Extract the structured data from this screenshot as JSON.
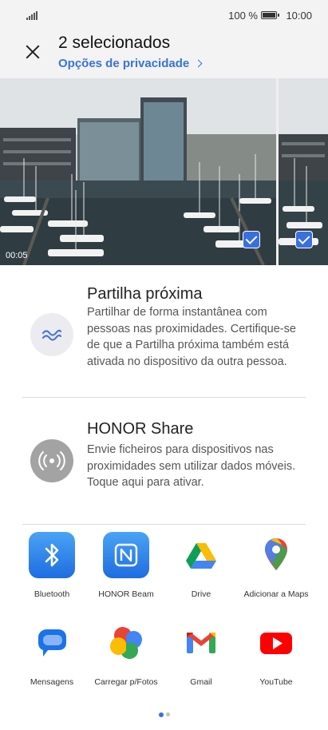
{
  "status": {
    "battery": "100 %",
    "time": "10:00"
  },
  "header": {
    "title": "2 selecionados",
    "privacy_link": "Opções de privacidade"
  },
  "media": [
    {
      "duration": "00:05",
      "selected": true
    },
    {
      "selected": true
    }
  ],
  "share_options": [
    {
      "title": "Partilha próxima",
      "description": "Partilhar de forma instantânea com pessoas nas proximidades. Certifique-se de que a Partilha próxima também está ativada no dispositivo da outra pessoa.",
      "icon": "nearby-share-icon"
    },
    {
      "title": "HONOR Share",
      "description": "Envie ficheiros para dispositivos nas proximidades sem utilizar dados móveis. Toque aqui para ativar.",
      "icon": "honor-share-icon"
    }
  ],
  "apps": [
    {
      "label": "Bluetooth",
      "icon": "bluetooth-icon"
    },
    {
      "label": "HONOR Beam",
      "icon": "nfc-icon"
    },
    {
      "label": "Drive",
      "icon": "drive-icon"
    },
    {
      "label": "Adicionar a Maps",
      "icon": "maps-icon"
    },
    {
      "label": "Mensagens",
      "icon": "messages-icon"
    },
    {
      "label": "Carregar p/Fotos",
      "icon": "photos-icon"
    },
    {
      "label": "Gmail",
      "icon": "gmail-icon"
    },
    {
      "label": "YouTube",
      "icon": "youtube-icon"
    }
  ],
  "pager": {
    "pages": 2,
    "current": 1
  },
  "colors": {
    "accent": "#3a72d8",
    "header_bg": "#f3f3f3"
  }
}
